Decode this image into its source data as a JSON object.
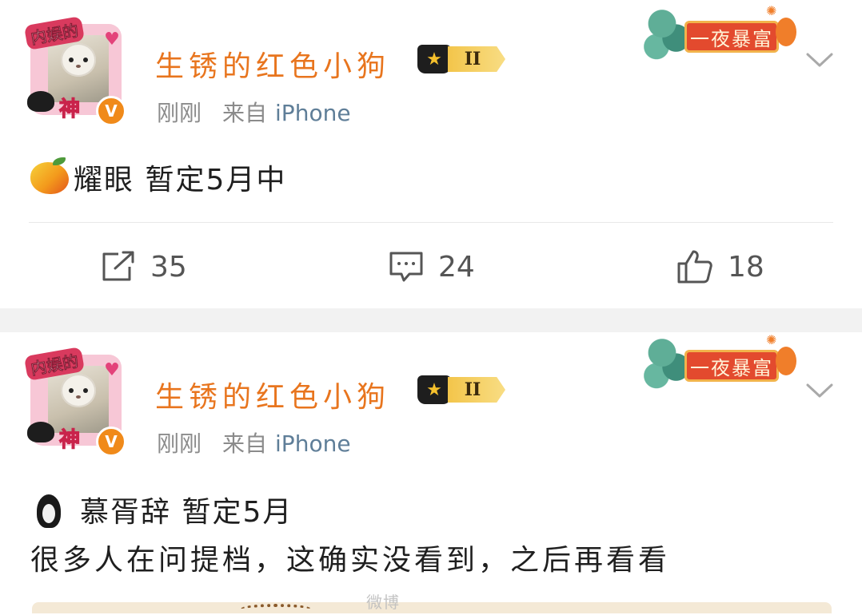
{
  "posts": [
    {
      "username": "生锈的红色小狗",
      "avatar_tag": "内娱的",
      "avatar_shen": "神",
      "verified_mark": "V",
      "rank_level": "II",
      "time": "刚刚",
      "source_prefix": "来自",
      "device": "iPhone",
      "badge_label": "一夜暴富",
      "content_line1": "耀眼 暂定5月中",
      "emoji": "mango",
      "actions": {
        "share_count": "35",
        "comment_count": "24",
        "like_count": "18"
      }
    },
    {
      "username": "生锈的红色小狗",
      "avatar_tag": "内娱的",
      "avatar_shen": "神",
      "verified_mark": "V",
      "rank_level": "II",
      "time": "刚刚",
      "source_prefix": "来自",
      "device": "iPhone",
      "badge_label": "一夜暴富",
      "content_line1": "慕胥辞 暂定5月",
      "content_line2": "很多人在问提档，这确实没看到，之后再看看",
      "emoji": "penguin",
      "watermark": "微博"
    }
  ],
  "icons": {
    "share": "share-icon",
    "comment": "comment-icon",
    "like": "thumbs-up-icon",
    "more": "chevron-down-icon"
  },
  "colors": {
    "username": "#e8751e",
    "meta": "#8b8b8b",
    "device": "#5f7e98",
    "badge": "#e34a2e",
    "separator": "#f2f2f2"
  }
}
